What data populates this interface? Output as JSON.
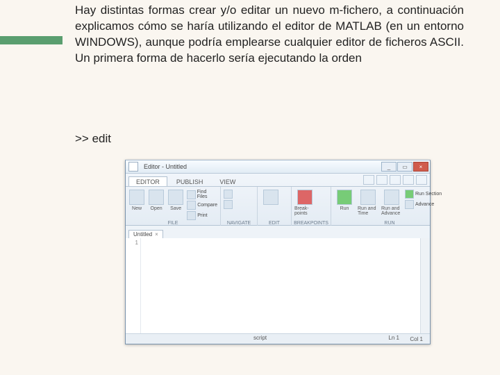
{
  "intro": "Hay distintas formas crear y/o editar un nuevo m-fichero, a continuación explicamos cómo se haría utilizando el editor de MATLAB (en un entorno WINDOWS), aunque podría emplearse cualquier editor de ficheros ASCII. Un primera forma de hacerlo sería ejecutando la orden",
  "prompt": ">> edit",
  "window": {
    "title": "Editor - Untitled",
    "controls": {
      "min": "_",
      "max": "▭",
      "close": "×"
    },
    "tabs": {
      "editor": "EDITOR",
      "publish": "PUBLISH",
      "view": "VIEW"
    },
    "file": {
      "label": "FILE",
      "new": "New",
      "open": "Open",
      "save": "Save",
      "findFiles": "Find Files",
      "compare": "Compare",
      "print": "Print"
    },
    "navigate": {
      "label": "NAVIGATE"
    },
    "edit": {
      "label": "EDIT"
    },
    "breakpoints": {
      "label": "BREAKPOINTS",
      "btn": "Break-points"
    },
    "run": {
      "label": "RUN",
      "run": "Run",
      "runTime": "Run and Time",
      "runAdvance": "Run and Advance",
      "runSection": "Run Section",
      "advance": "Advance"
    },
    "doc": {
      "name": "Untitled",
      "close": "×"
    },
    "gutter": "1",
    "status": {
      "type": "script",
      "ln": "Ln  1",
      "col": "Col  1"
    }
  }
}
